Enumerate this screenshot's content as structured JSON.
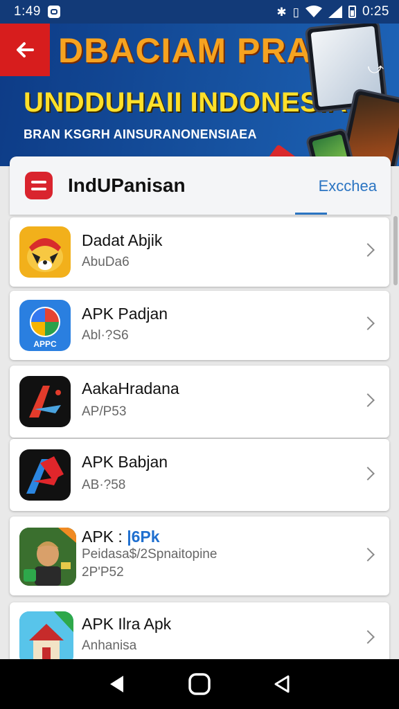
{
  "status_bar": {
    "time": "1:49",
    "clock_right": "0:25",
    "icons": [
      "notification-icon",
      "bluetooth-icon",
      "vibrate-icon",
      "wifi-icon",
      "signal-icon",
      "battery-icon"
    ]
  },
  "banner": {
    "title": "DBACIAM PRAR",
    "subtitle": "UNDDUHAII INDONESIA",
    "tagline": "BRAN KSGRH AINSURANONENSIAEA",
    "colors": {
      "bg": "#124b9a",
      "title": "#f6a320",
      "subtitle": "#ffe02a",
      "back_button": "#d71d1d"
    }
  },
  "app_header": {
    "name": "IndUPanisan",
    "tab_label": "Excchea",
    "accent": "#2a74c2"
  },
  "apps": [
    {
      "title": "Dadat Abjik",
      "subtitle": "AbuDa6",
      "icon": "raccoon-mask-icon"
    },
    {
      "title": "APK Padjan",
      "subtitle": "Abl·?S6",
      "icon": "apk-compass-icon"
    },
    {
      "title": "AakaHradana",
      "subtitle": "AP/P53",
      "icon": "red-a-arrow-icon"
    },
    {
      "title": "APK Babjan",
      "subtitle": "AB·?58",
      "icon": "red-blue-a-icon"
    },
    {
      "title_prefix": "APK : ",
      "title_highlight": "|6Pk",
      "subtitle": "Peidasa$/2Spnaitopine",
      "subtitle2": "2P'P52",
      "icon": "avatar-money-icon"
    },
    {
      "title": "APK Ilra Apk",
      "subtitle": "Anhanisa",
      "icon": "house-game-icon"
    }
  ],
  "nav_bar": {
    "buttons": [
      "back-triangle-icon",
      "home-circle-icon",
      "recents-triangle-icon"
    ]
  }
}
